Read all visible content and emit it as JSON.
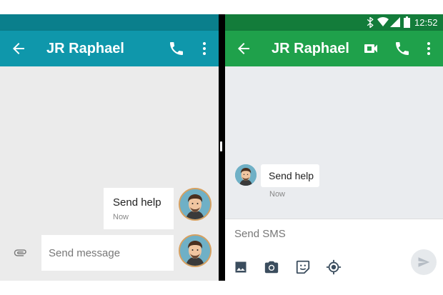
{
  "left": {
    "title": "JR Raphael",
    "messages": [
      {
        "text": "Send help",
        "time": "Now"
      }
    ],
    "compose_placeholder": "Send message"
  },
  "right": {
    "status_time": "12:52",
    "title": "JR Raphael",
    "messages": [
      {
        "text": "Send help",
        "time": "Now"
      }
    ],
    "compose_placeholder": "Send SMS"
  },
  "colors": {
    "left_appbar": "#0f97ab",
    "left_status": "#0a7f8c",
    "right_appbar": "#1fa14b",
    "right_status": "#137c3a"
  },
  "icons": [
    "back-arrow-icon",
    "phone-icon",
    "more-vert-icon",
    "video-call-icon",
    "bluetooth-icon",
    "wifi-icon",
    "signal-icon",
    "battery-icon",
    "attach-icon",
    "image-icon",
    "camera-icon",
    "sticker-icon",
    "location-icon",
    "send-icon"
  ]
}
